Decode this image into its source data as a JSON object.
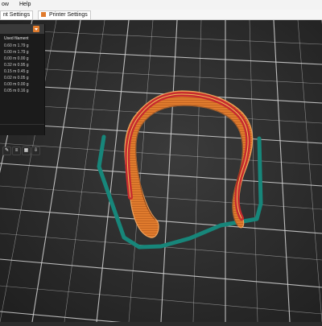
{
  "menubar": {
    "items": [
      "ow",
      "Help"
    ]
  },
  "tabs": [
    {
      "label": "nt Settings"
    },
    {
      "label": "Printer Settings"
    }
  ],
  "filament_panel": {
    "header": "Used filament",
    "rows": [
      {
        "label": "0.60 m   1.79 g"
      },
      {
        "label": "0.00 m   1.79 g"
      },
      {
        "label": "0.00 m   0.00 g"
      },
      {
        "label": "0.32 m   0.95 g"
      },
      {
        "label": "0.15 m   0.45 g"
      },
      {
        "label": "0.02 m   0.05 g"
      },
      {
        "label": "0.00 m   0.00 g"
      },
      {
        "label": "0.05 m   0.16 g"
      }
    ]
  },
  "icons": [
    "dropdown-icon",
    "brush-icon",
    "layers-icon",
    "cube-icon",
    "export-icon"
  ],
  "colors": {
    "bed": "#2c2c2c",
    "grid": "#cfcfcf",
    "print": "#e07b2d",
    "perimeter": "#c72b2f",
    "skirt": "#17867a"
  }
}
